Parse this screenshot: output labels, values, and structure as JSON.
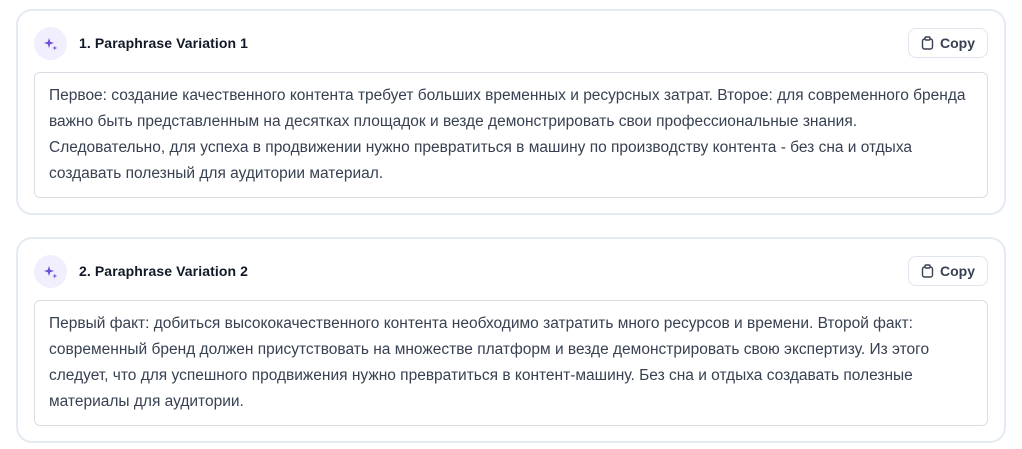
{
  "variations": [
    {
      "title": "1. Paraphrase Variation 1",
      "copy_label": "Copy",
      "badge_icon": "sparkle-icon",
      "text": "Первое: создание качественного контента требует больших временных и ресурсных затрат. Второе: для современного бренда важно быть представленным на десятках площадок и везде демонстрировать свои профессиональные знания. Следовательно, для успеха в продвижении нужно превратиться в машину по производству контента - без сна и отдыха создавать полезный для аудитории материал."
    },
    {
      "title": "2. Paraphrase Variation 2",
      "copy_label": "Copy",
      "badge_icon": "sparkle-icon",
      "text": "Первый факт: добиться высококачественного контента необходимо затратить много ресурсов и времени. Второй факт: современный бренд должен присутствовать на множестве платформ и везде демонстрировать свою экспертизу. Из этого следует, что для успешного продвижения нужно превратиться в контент-машину. Без сна и отдыха создавать полезные материалы для аудитории."
    }
  ],
  "colors": {
    "accent": "#6d4fd8",
    "badge_bg": "#f1eefd",
    "card_border": "#e4ebf2",
    "text": "#374151"
  },
  "copy_icon": "clipboard-icon"
}
